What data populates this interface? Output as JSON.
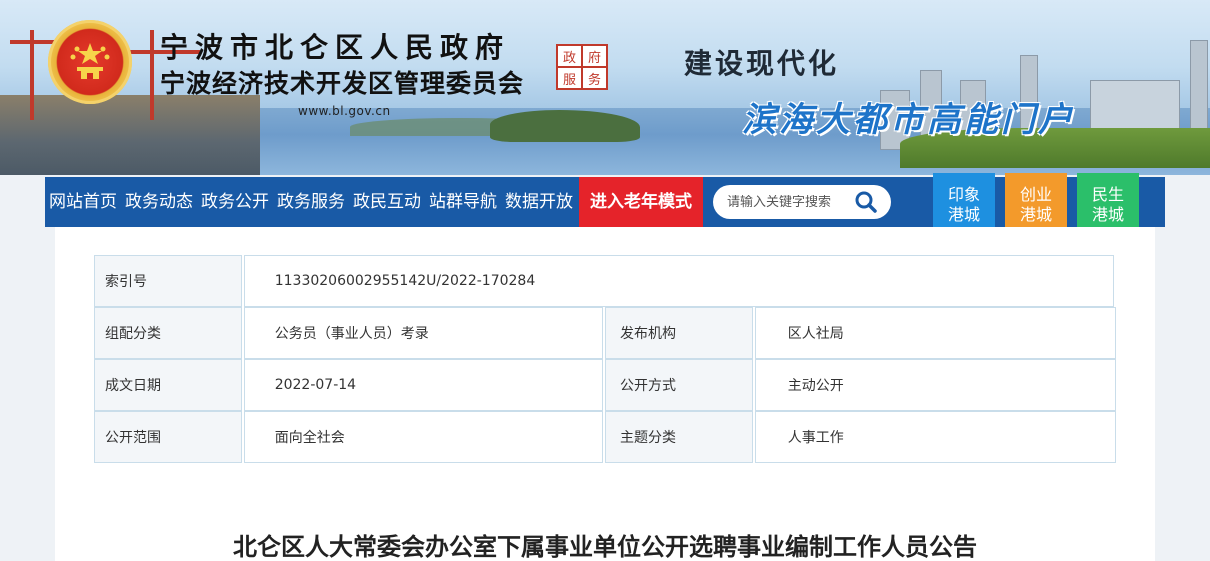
{
  "header": {
    "title": "宁波市北仑区人民政府",
    "subtitle": "宁波经济技术开发区管理委员会",
    "url": "www.bl.gov.cn",
    "seal_chars": [
      "政",
      "府",
      "服",
      "务"
    ],
    "slogan_line1": "建设现代化",
    "slogan_line2": "滨海大都市高能门户",
    "emblem_icon": "national-emblem-icon"
  },
  "nav": {
    "items": [
      "网站首页",
      "政务动态",
      "政务公开",
      "政务服务",
      "政民互动",
      "站群导航",
      "数据开放"
    ],
    "elder_mode": "进入老年模式",
    "search_placeholder": "请输入关键字搜索",
    "search_icon": "search-icon"
  },
  "tiles": [
    {
      "line1": "印象",
      "line2": "港城",
      "color": "#1e90e0"
    },
    {
      "line1": "创业",
      "line2": "港城",
      "color": "#f39a2b"
    },
    {
      "line1": "民生",
      "line2": "港城",
      "color": "#2bbf6a"
    }
  ],
  "info": {
    "index_label": "索引号",
    "index_value": "113302060029551​42U/2022-170284",
    "category_label": "组配分类",
    "category_value": "公务员（事业人员）考录",
    "issuer_label": "发布机构",
    "issuer_value": "区人社局",
    "date_label": "成文日期",
    "date_value": "2022-07-14",
    "method_label": "公开方式",
    "method_value": "主动公开",
    "scope_label": "公开范围",
    "scope_value": "面向全社会",
    "topic_label": "主题分类",
    "topic_value": "人事工作"
  },
  "article": {
    "title": "北仑区人大常委会办公室下属事业单位公开选聘事业编制工作人员公告"
  },
  "colors": {
    "nav_bg": "#195aa6",
    "elder_bg": "#e5232a",
    "slogan_blue": "#1e74c9"
  }
}
